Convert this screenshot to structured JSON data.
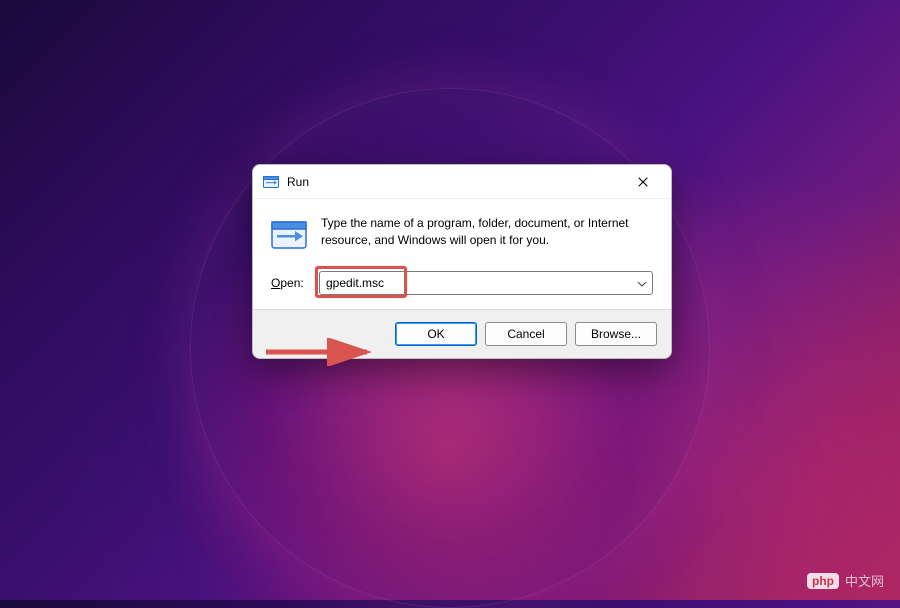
{
  "dialog": {
    "title": "Run",
    "description": "Type the name of a program, folder, document, or Internet resource, and Windows will open it for you.",
    "open_label": "Open:",
    "input_value": "gpedit.msc",
    "buttons": {
      "ok": "OK",
      "cancel": "Cancel",
      "browse": "Browse..."
    }
  },
  "annotations": {
    "highlight_target": "open-input",
    "arrow_target": "ok-button",
    "arrow_color": "#d9534f",
    "highlight_color": "#d9534f"
  },
  "watermark": {
    "logo": "php",
    "text": "中文网"
  }
}
